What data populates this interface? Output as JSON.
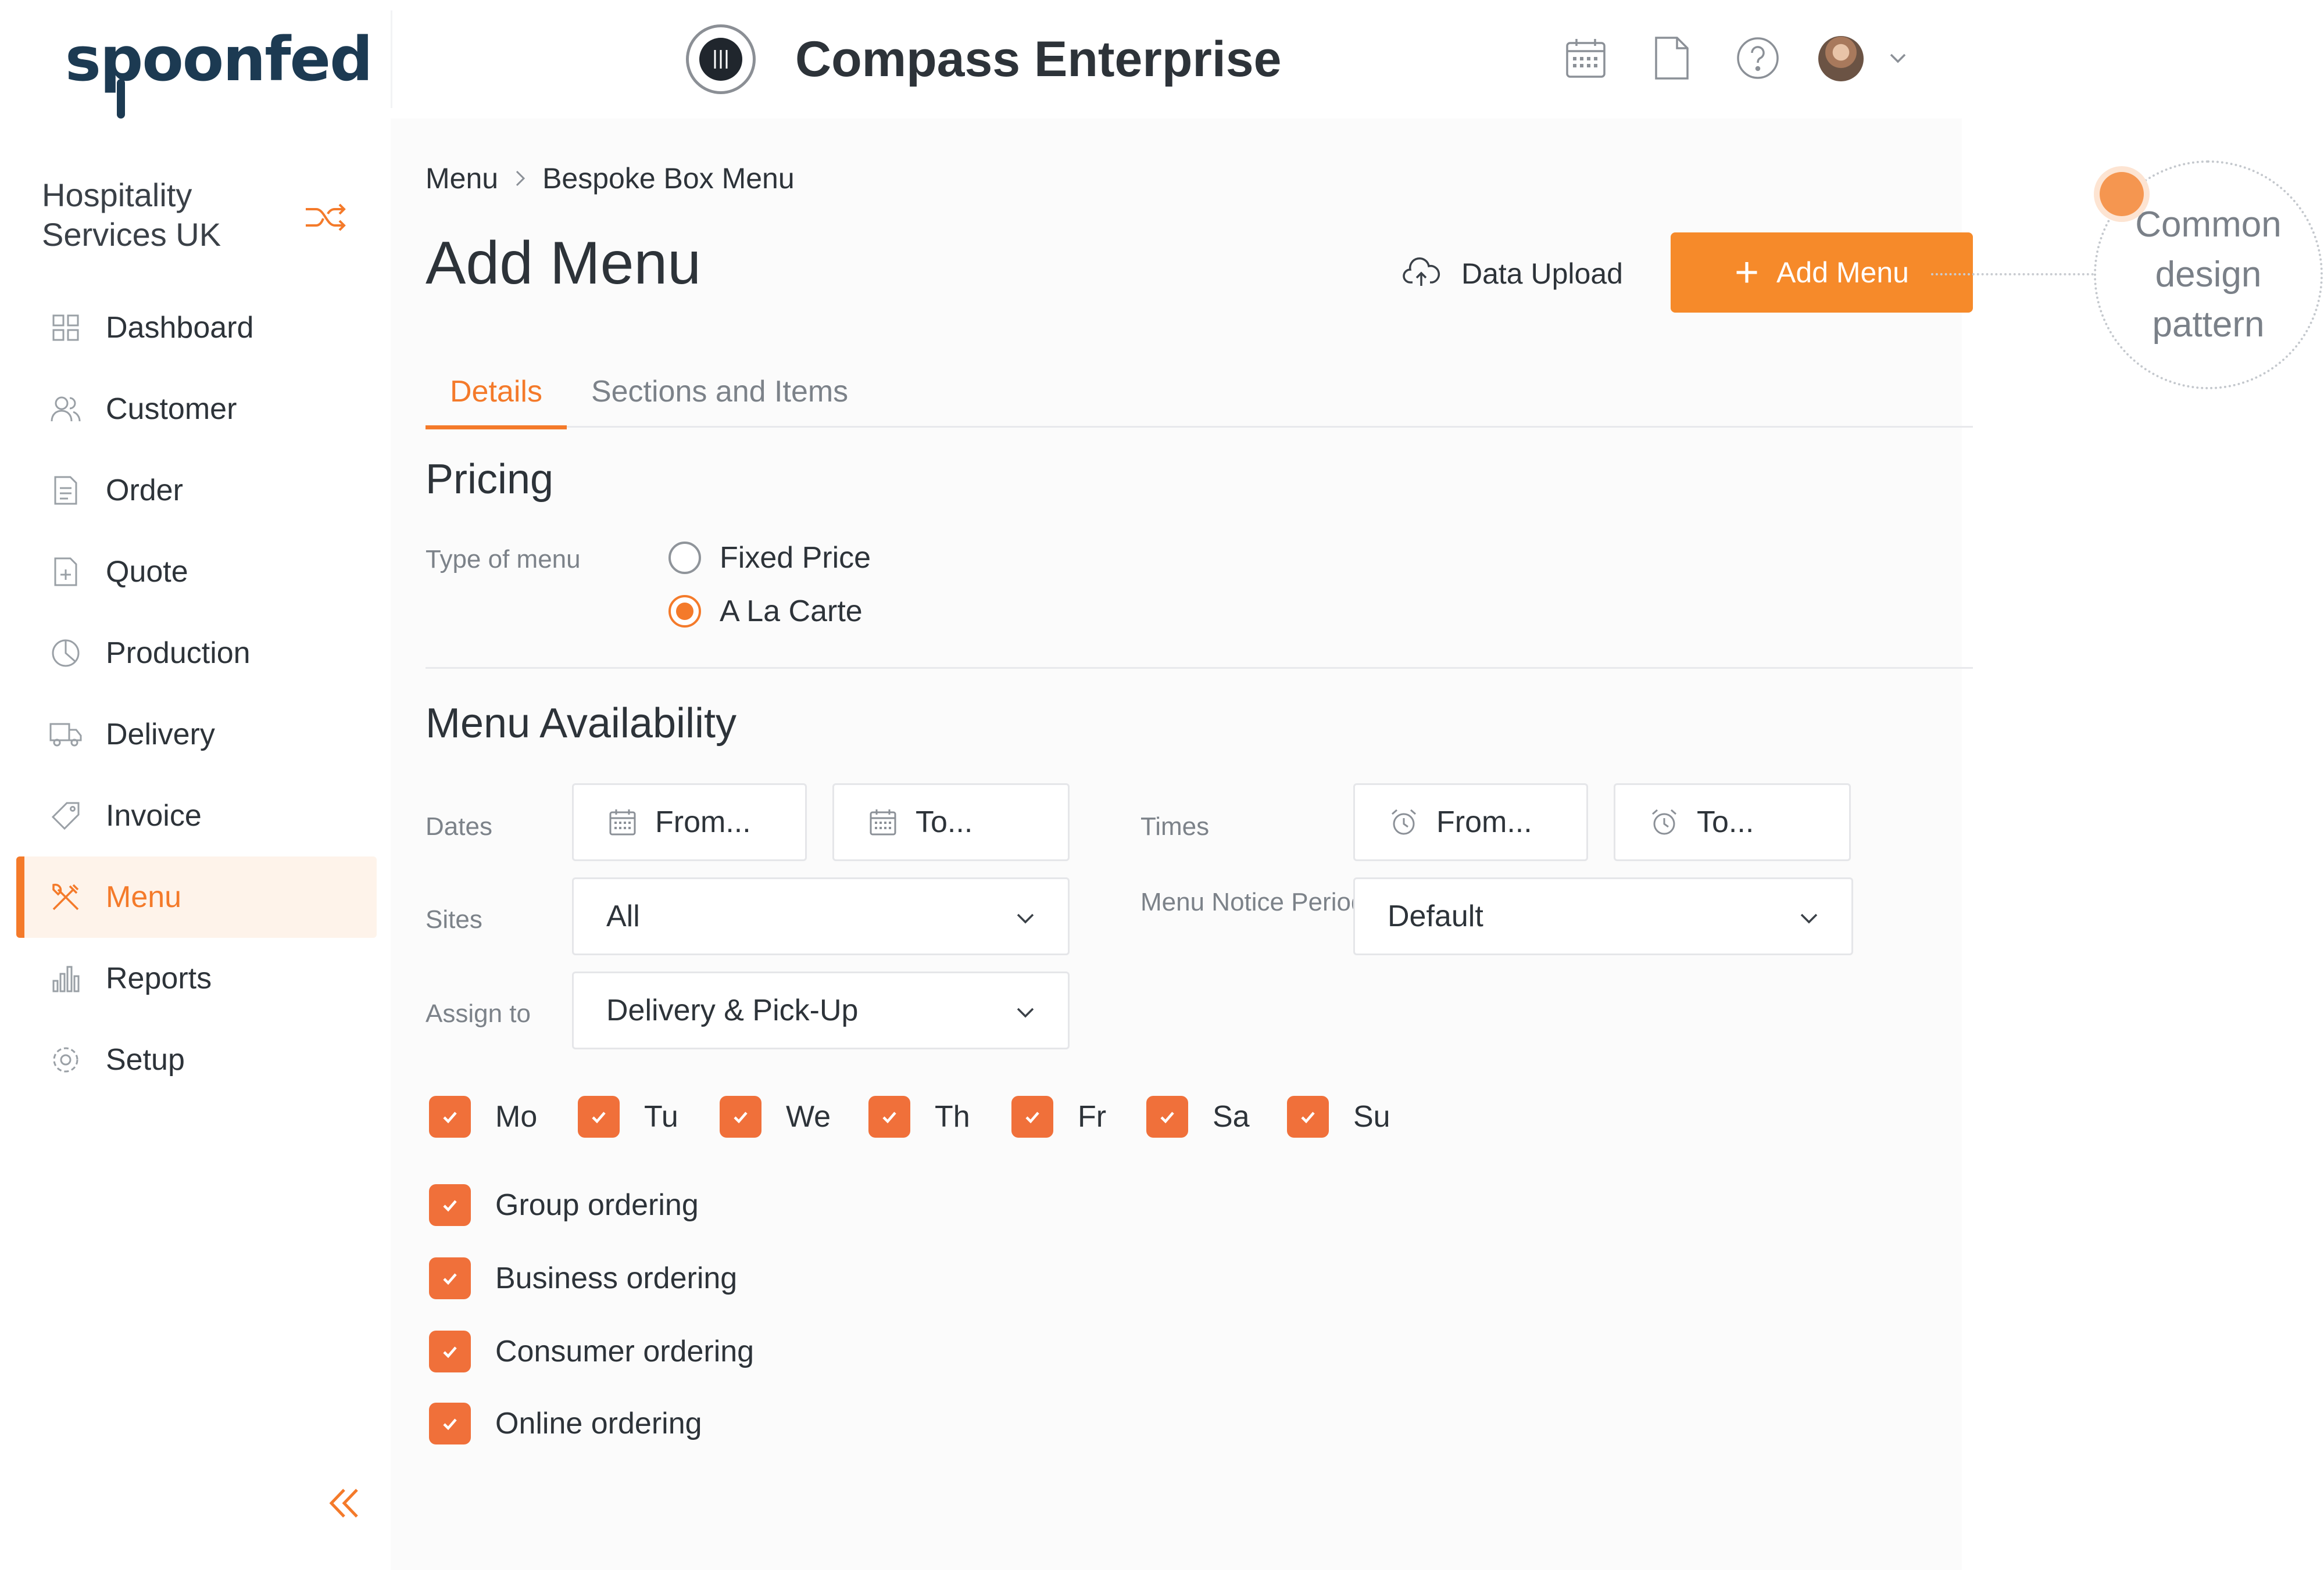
{
  "brand": {
    "logo_prefix": "s",
    "logo_spoon": "p",
    "logo_suffix": "oonfed"
  },
  "header": {
    "title": "Compass Enterprise",
    "icons": [
      "calendar-icon",
      "document-icon",
      "help-icon",
      "user-avatar",
      "chevron-down-icon"
    ]
  },
  "sidebar": {
    "org_name": "Hospitality Services UK",
    "items": [
      {
        "label": "Dashboard",
        "icon": "dashboard-icon",
        "active": false
      },
      {
        "label": "Customer",
        "icon": "users-icon",
        "active": false
      },
      {
        "label": "Order",
        "icon": "order-icon",
        "active": false
      },
      {
        "label": "Quote",
        "icon": "quote-icon",
        "active": false
      },
      {
        "label": "Production",
        "icon": "production-icon",
        "active": false
      },
      {
        "label": "Delivery",
        "icon": "truck-icon",
        "active": false
      },
      {
        "label": "Invoice",
        "icon": "tag-icon",
        "active": false
      },
      {
        "label": "Menu",
        "icon": "cutlery-icon",
        "active": true
      },
      {
        "label": "Reports",
        "icon": "chart-icon",
        "active": false
      },
      {
        "label": "Setup",
        "icon": "gear-icon",
        "active": false
      }
    ]
  },
  "breadcrumb": {
    "parent": "Menu",
    "current": "Bespoke Box Menu"
  },
  "page": {
    "title": "Add Menu",
    "upload_label": "Data Upload",
    "add_button_label": "Add Menu"
  },
  "tabs": [
    {
      "label": "Details",
      "active": true
    },
    {
      "label": "Sections and Items",
      "active": false
    }
  ],
  "pricing": {
    "title": "Pricing",
    "type_label": "Type of menu",
    "options": [
      {
        "label": "Fixed Price",
        "selected": false
      },
      {
        "label": "A La Carte",
        "selected": true
      }
    ]
  },
  "availability": {
    "title": "Menu Availability",
    "dates_label": "Dates",
    "date_from_placeholder": "From...",
    "date_to_placeholder": "To...",
    "times_label": "Times",
    "time_from_placeholder": "From...",
    "time_to_placeholder": "To...",
    "sites_label": "Sites",
    "sites_value": "All",
    "notice_label": "Menu Notice Period",
    "notice_value": "Default",
    "assign_label": "Assign to",
    "assign_value": "Delivery & Pick-Up",
    "days": [
      {
        "label": "Mo",
        "checked": true
      },
      {
        "label": "Tu",
        "checked": true
      },
      {
        "label": "We",
        "checked": true
      },
      {
        "label": "Th",
        "checked": true
      },
      {
        "label": "Fr",
        "checked": true
      },
      {
        "label": "Sa",
        "checked": true
      },
      {
        "label": "Su",
        "checked": true
      }
    ],
    "ordering": [
      {
        "label": "Group ordering",
        "checked": true
      },
      {
        "label": "Business ordering",
        "checked": true
      },
      {
        "label": "Consumer ordering",
        "checked": true
      },
      {
        "label": "Online ordering",
        "checked": true
      }
    ]
  },
  "annotation": {
    "text": "Common design pattern"
  },
  "colors": {
    "accent": "#f47a2a",
    "button": "#f68a2a",
    "checkbox": "#f0703a",
    "navy": "#1c3a52"
  }
}
